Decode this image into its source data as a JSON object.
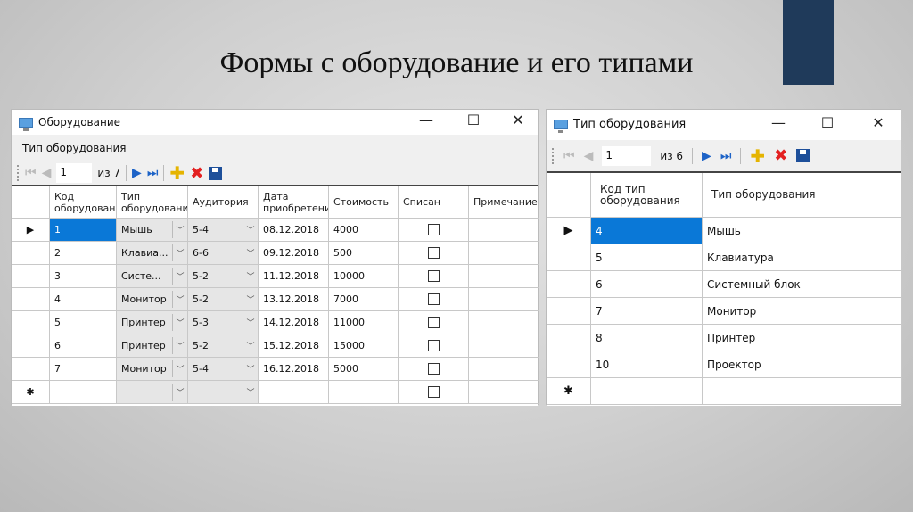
{
  "slide_title": "Формы с оборудование и его типами",
  "left_window": {
    "title": "Оборудование",
    "menu": [
      "Тип оборудования"
    ],
    "nav": {
      "position": "1",
      "of": "из 7"
    },
    "columns": [
      "Код оборудования",
      "Тип оборудования",
      "Аудитория",
      "Дата приобретения",
      "Стоимость",
      "Списан",
      "Примечание"
    ],
    "rows": [
      {
        "id": "1",
        "type": "Мышь",
        "room": "5-4",
        "date": "08.12.2018",
        "cost": "4000",
        "writtenoff": false,
        "note": ""
      },
      {
        "id": "2",
        "type": "Клавиа...",
        "room": "6-6",
        "date": "09.12.2018",
        "cost": "500",
        "writtenoff": false,
        "note": ""
      },
      {
        "id": "3",
        "type": "Систе...",
        "room": "5-2",
        "date": "11.12.2018",
        "cost": "10000",
        "writtenoff": false,
        "note": ""
      },
      {
        "id": "4",
        "type": "Монитор",
        "room": "5-2",
        "date": "13.12.2018",
        "cost": "7000",
        "writtenoff": false,
        "note": ""
      },
      {
        "id": "5",
        "type": "Принтер",
        "room": "5-3",
        "date": "14.12.2018",
        "cost": "11000",
        "writtenoff": false,
        "note": ""
      },
      {
        "id": "6",
        "type": "Принтер",
        "room": "5-2",
        "date": "15.12.2018",
        "cost": "15000",
        "writtenoff": false,
        "note": ""
      },
      {
        "id": "7",
        "type": "Монитор",
        "room": "5-4",
        "date": "16.12.2018",
        "cost": "5000",
        "writtenoff": false,
        "note": ""
      }
    ]
  },
  "right_window": {
    "title": "Тип оборудования",
    "nav": {
      "position": "1",
      "of": "из 6"
    },
    "columns": [
      "Код тип оборудования",
      "Тип оборудования"
    ],
    "rows": [
      [
        "4",
        "Мышь"
      ],
      [
        "5",
        "Клавиатура"
      ],
      [
        "6",
        "Системный блок"
      ],
      [
        "7",
        "Монитор"
      ],
      [
        "8",
        "Принтер"
      ],
      [
        "10",
        "Проектор"
      ]
    ]
  },
  "glyphs": {
    "current": "▶",
    "new": "✱",
    "min": "—",
    "max": "☐",
    "close": "✕",
    "first": "⏮",
    "prev": "◀",
    "next": "▶",
    "last": "⏭",
    "drop": "﹀"
  }
}
